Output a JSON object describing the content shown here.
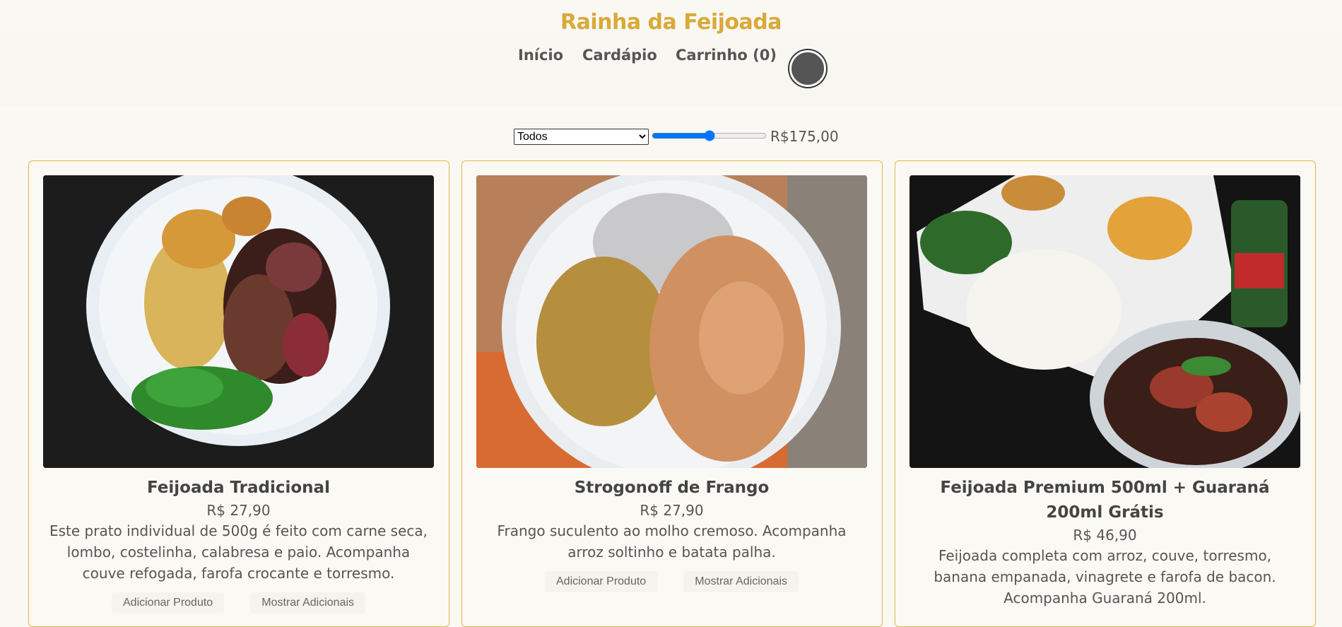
{
  "header": {
    "brand": "Rainha da Feijoada",
    "nav": [
      {
        "label": "Início"
      },
      {
        "label": "Cardápio"
      },
      {
        "label": "Carrinho (0)"
      }
    ]
  },
  "filters": {
    "category_selected": "Todos",
    "price_value": 0.5,
    "price_label": "R$175,00"
  },
  "products": [
    {
      "title": "Feijoada Tradicional",
      "price": "R$ 27,90",
      "description": "Este prato individual de 500g é feito com carne seca, lombo, costelinha, calabresa e paio. Acompanha couve refogada, farofa crocante e torresmo.",
      "add_label": "Adicionar Produto",
      "extras_label": "Mostrar Adicionais"
    },
    {
      "title": "Strogonoff de Frango",
      "price": "R$ 27,90",
      "description": "Frango suculento ao molho cremoso. Acompanha arroz soltinho e batata palha.",
      "add_label": "Adicionar Produto",
      "extras_label": "Mostrar Adicionais"
    },
    {
      "title": "Feijoada Premium 500ml + Guaraná 200ml Grátis",
      "price": "R$ 46,90",
      "description": "Feijoada completa com arroz, couve, torresmo, banana empanada, vinagrete e farofa de bacon. Acompanha Guaraná 200ml."
    }
  ],
  "colors": {
    "brand": "#d9a93a",
    "card_border": "#e2b84a",
    "background": "#faf8f3"
  }
}
